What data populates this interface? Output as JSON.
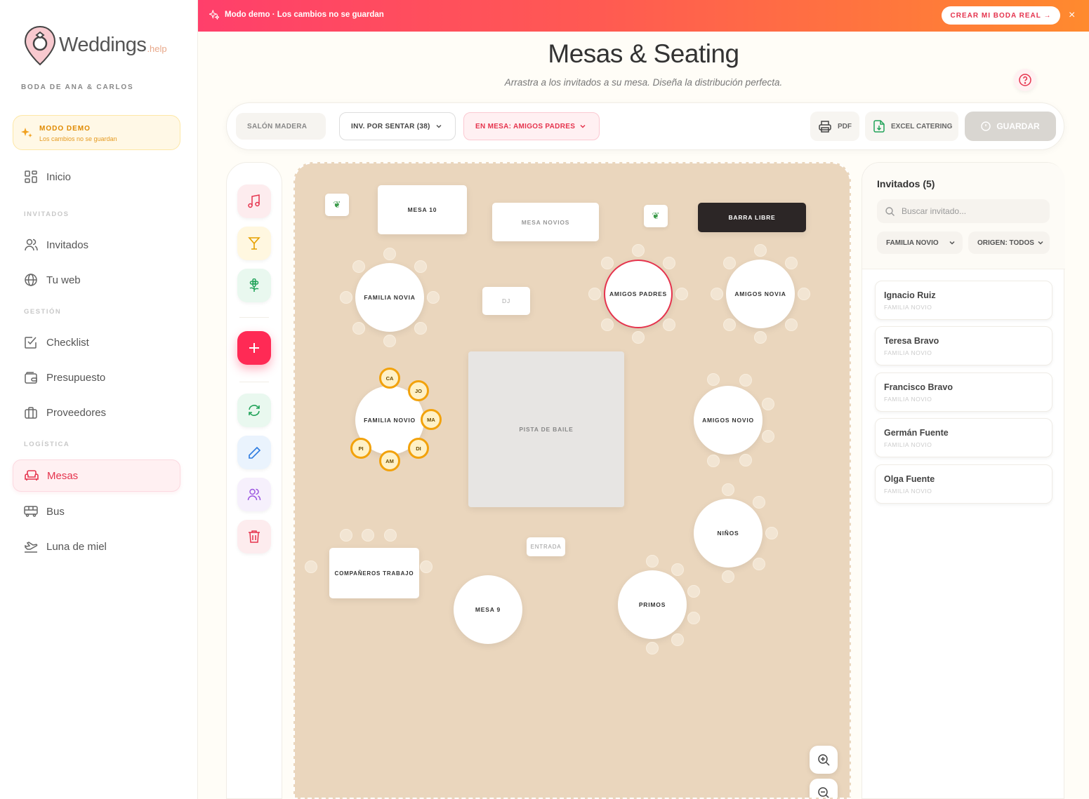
{
  "colors": {
    "accent": "#e5334d",
    "gold": "#f2a20b",
    "canvas": "#ead6bd"
  },
  "sidebar": {
    "logo_text": "Weddings",
    "logo_sub": ".help",
    "wedding_name": "BODA DE ANA & CARLOS",
    "demo_title": "MODO DEMO",
    "demo_sub": "Los cambios no se guardan",
    "sections": {
      "invitados": "INVITADOS",
      "gestion": "GESTIÓN",
      "logistica": "LOGÍSTICA"
    },
    "items": [
      {
        "label": "Inicio",
        "icon": "grid-icon"
      },
      {
        "label": "Invitados",
        "icon": "users-icon"
      },
      {
        "label": "Tu web",
        "icon": "globe-icon"
      },
      {
        "label": "Checklist",
        "icon": "checklist-icon"
      },
      {
        "label": "Presupuesto",
        "icon": "wallet-icon"
      },
      {
        "label": "Proveedores",
        "icon": "briefcase-icon"
      },
      {
        "label": "Mesas",
        "icon": "sofa-icon",
        "active": true
      },
      {
        "label": "Bus",
        "icon": "bus-icon"
      },
      {
        "label": "Luna de miel",
        "icon": "plane-icon"
      }
    ]
  },
  "banner": {
    "text": "Modo demo · Los cambios no se guardan",
    "cta": "CREAR MI BODA REAL →",
    "close": "×"
  },
  "header": {
    "title": "Mesas & Seating",
    "subtitle": "Arrastra a los invitados a su mesa. Diseña la distribución perfecta."
  },
  "toolbar": {
    "salon": "SALÓN MADERA",
    "select_unseated": "INV. POR SENTAR (38)",
    "select_table": "EN MESA: AMIGOS PADRES",
    "pdf": "PDF",
    "excel": "EXCEL CATERING",
    "save": "GUARDAR"
  },
  "tools": [
    "music-icon",
    "cocktail-icon",
    "flower-icon",
    "plus-icon",
    "refresh-icon",
    "pencil-icon",
    "users-icon",
    "trash-icon"
  ],
  "canvas": {
    "tables": {
      "mesa10": "MESA 10",
      "novios": "MESA NOVIOS",
      "barra": "BARRA LIBRE",
      "dj": "DJ",
      "familia_novia": "FAMILIA NOVIA",
      "amigos_padres": "AMIGOS PADRES",
      "amigos_novia": "AMIGOS NOVIA",
      "familia_novio": "FAMILIA NOVIO",
      "pista": "PISTA DE BAILE",
      "amigos_novio": "AMIGOS NOVIO",
      "ninos": "NIÑOS",
      "entrada": "ENTRADA",
      "companeros": "COMPAÑEROS TRABAJO",
      "mesa9": "MESA 9",
      "primos": "PRIMOS"
    },
    "familia_novio_seats": [
      "CA",
      "JO",
      "MA",
      "DI",
      "AM",
      "PI"
    ]
  },
  "guests_panel": {
    "title": "Invitados (5)",
    "search_placeholder": "Buscar invitado...",
    "filter_group": "FAMILIA NOVIO",
    "filter_origin": "ORIGEN: TODOS",
    "guests": [
      {
        "name": "Ignacio Ruiz",
        "group": "FAMILIA NOVIO"
      },
      {
        "name": "Teresa Bravo",
        "group": "FAMILIA NOVIO"
      },
      {
        "name": "Francisco Bravo",
        "group": "FAMILIA NOVIO"
      },
      {
        "name": "Germán Fuente",
        "group": "FAMILIA NOVIO"
      },
      {
        "name": "Olga Fuente",
        "group": "FAMILIA NOVIO"
      }
    ]
  }
}
